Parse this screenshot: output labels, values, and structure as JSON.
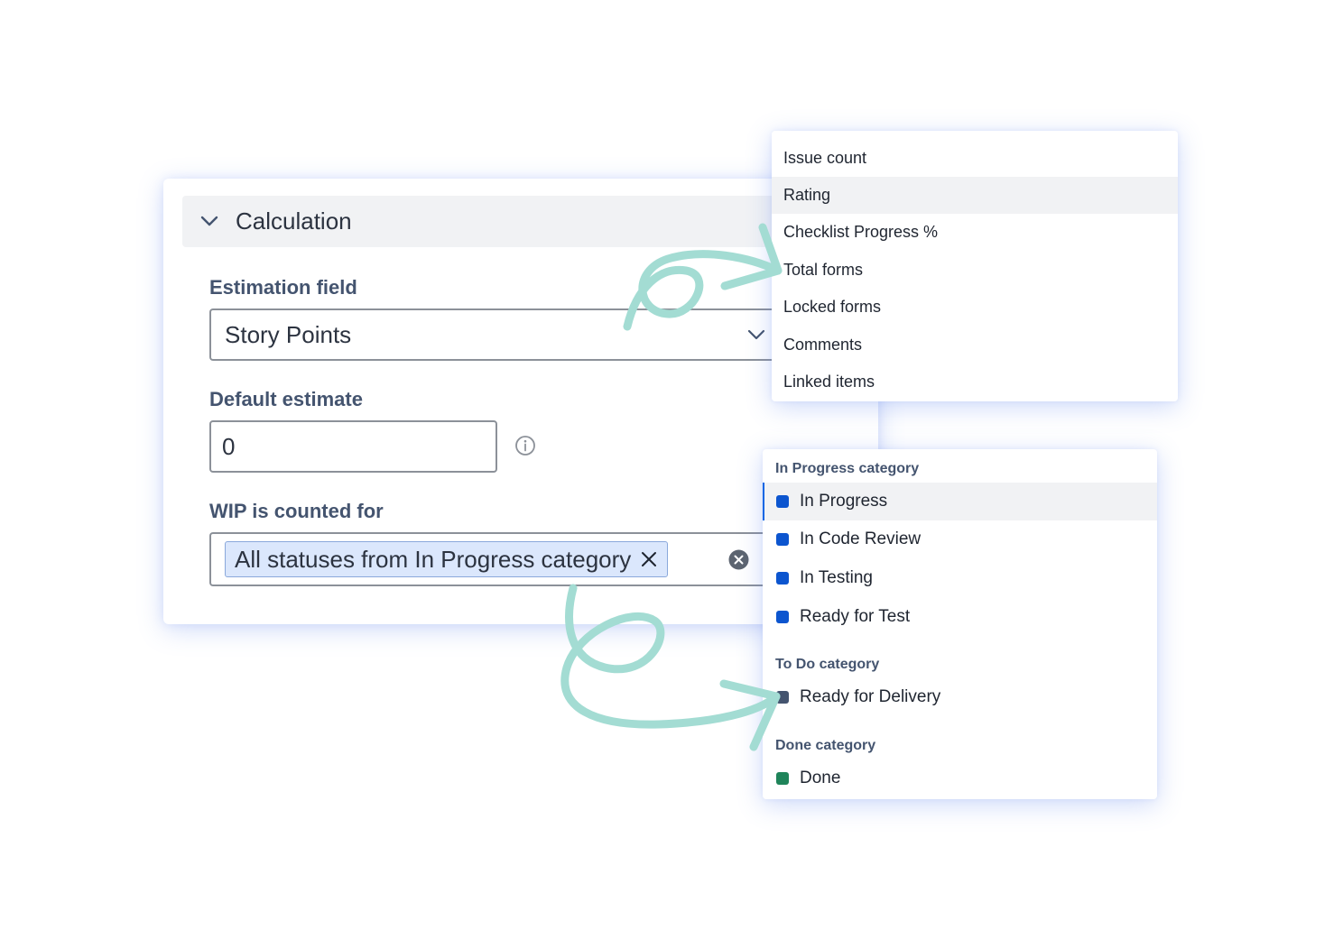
{
  "calculation": {
    "title": "Calculation",
    "estimation_field": {
      "label": "Estimation field",
      "value": "Story Points"
    },
    "default_estimate": {
      "label": "Default estimate",
      "value": "0"
    },
    "wip": {
      "label": "WIP is counted for",
      "tag": "All statuses from In Progress category"
    }
  },
  "estimation_options": [
    {
      "label": "Issue count"
    },
    {
      "label": "Rating"
    },
    {
      "label": "Checklist Progress %"
    },
    {
      "label": "Total forms"
    },
    {
      "label": "Locked forms"
    },
    {
      "label": "Comments"
    },
    {
      "label": "Linked items"
    }
  ],
  "status_groups": [
    {
      "label": "In Progress category",
      "color": "#0c55cf",
      "items": [
        {
          "label": "In Progress"
        },
        {
          "label": "In Code Review"
        },
        {
          "label": "In Testing"
        },
        {
          "label": "Ready for Test"
        }
      ]
    },
    {
      "label": "To Do category",
      "color": "#44546f",
      "items": [
        {
          "label": "Ready for Delivery"
        }
      ]
    },
    {
      "label": "Done category",
      "color": "#1f845a",
      "items": [
        {
          "label": "Done"
        }
      ]
    }
  ],
  "theme": {
    "arrow_color": "#a3dcd3",
    "selected_background": "#dbe7fc"
  }
}
